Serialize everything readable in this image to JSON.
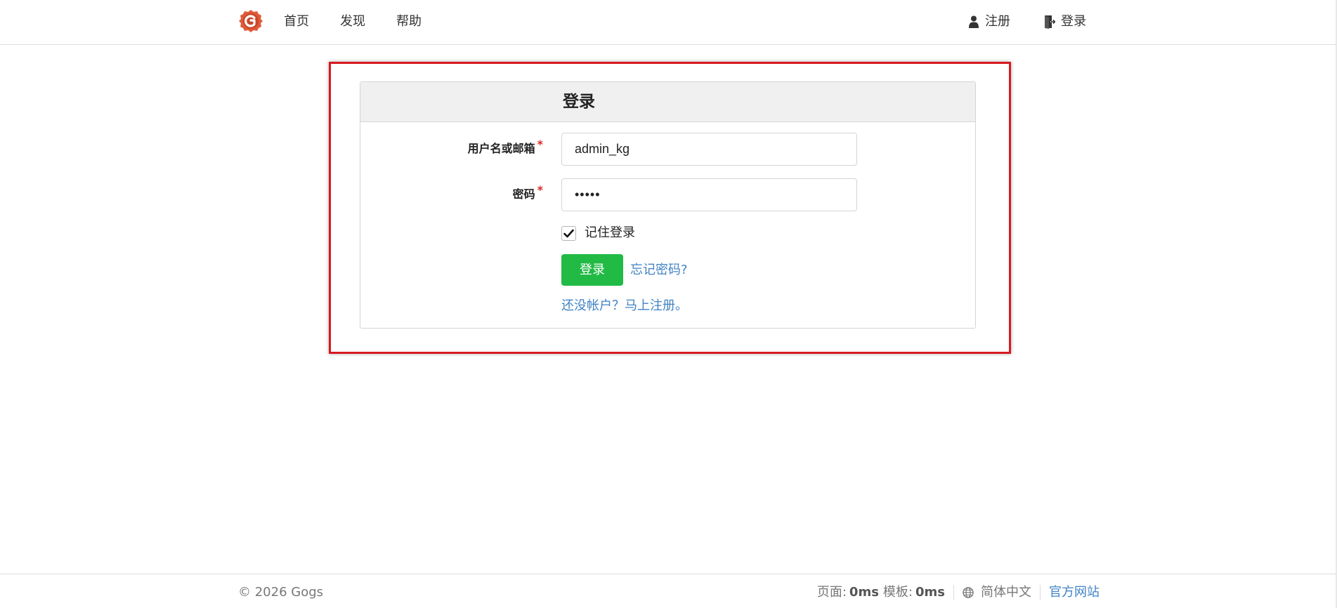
{
  "nav": {
    "home": "首页",
    "explore": "发现",
    "help": "帮助",
    "register": "注册",
    "signin": "登录"
  },
  "form": {
    "title": "登录",
    "username_label": "用户名或邮箱",
    "username_value": "admin_kg",
    "password_label": "密码",
    "password_mask": "•••••",
    "required_mark": "*",
    "remember_label": "记住登录",
    "remember_checked": true,
    "submit_label": "登录",
    "forgot_link": "忘记密码?",
    "signup_link": "还没帐户？马上注册。"
  },
  "footer": {
    "copyright": "© 2026 Gogs",
    "page_label": "页面:",
    "page_time": "0ms",
    "template_label": "模板:",
    "template_time": "0ms",
    "language": "简体中文",
    "official_site": "官方网站"
  },
  "colors": {
    "brand": "#e05a3a",
    "primary_button": "#21ba45",
    "link": "#4183c4",
    "highlight_border": "#d71920",
    "required": "#db2828"
  },
  "icons": {
    "logo": "gogs-logo-icon",
    "register": "user-icon",
    "signin": "sign-in-icon",
    "language": "globe-icon",
    "checkbox": "checkmark-icon"
  }
}
